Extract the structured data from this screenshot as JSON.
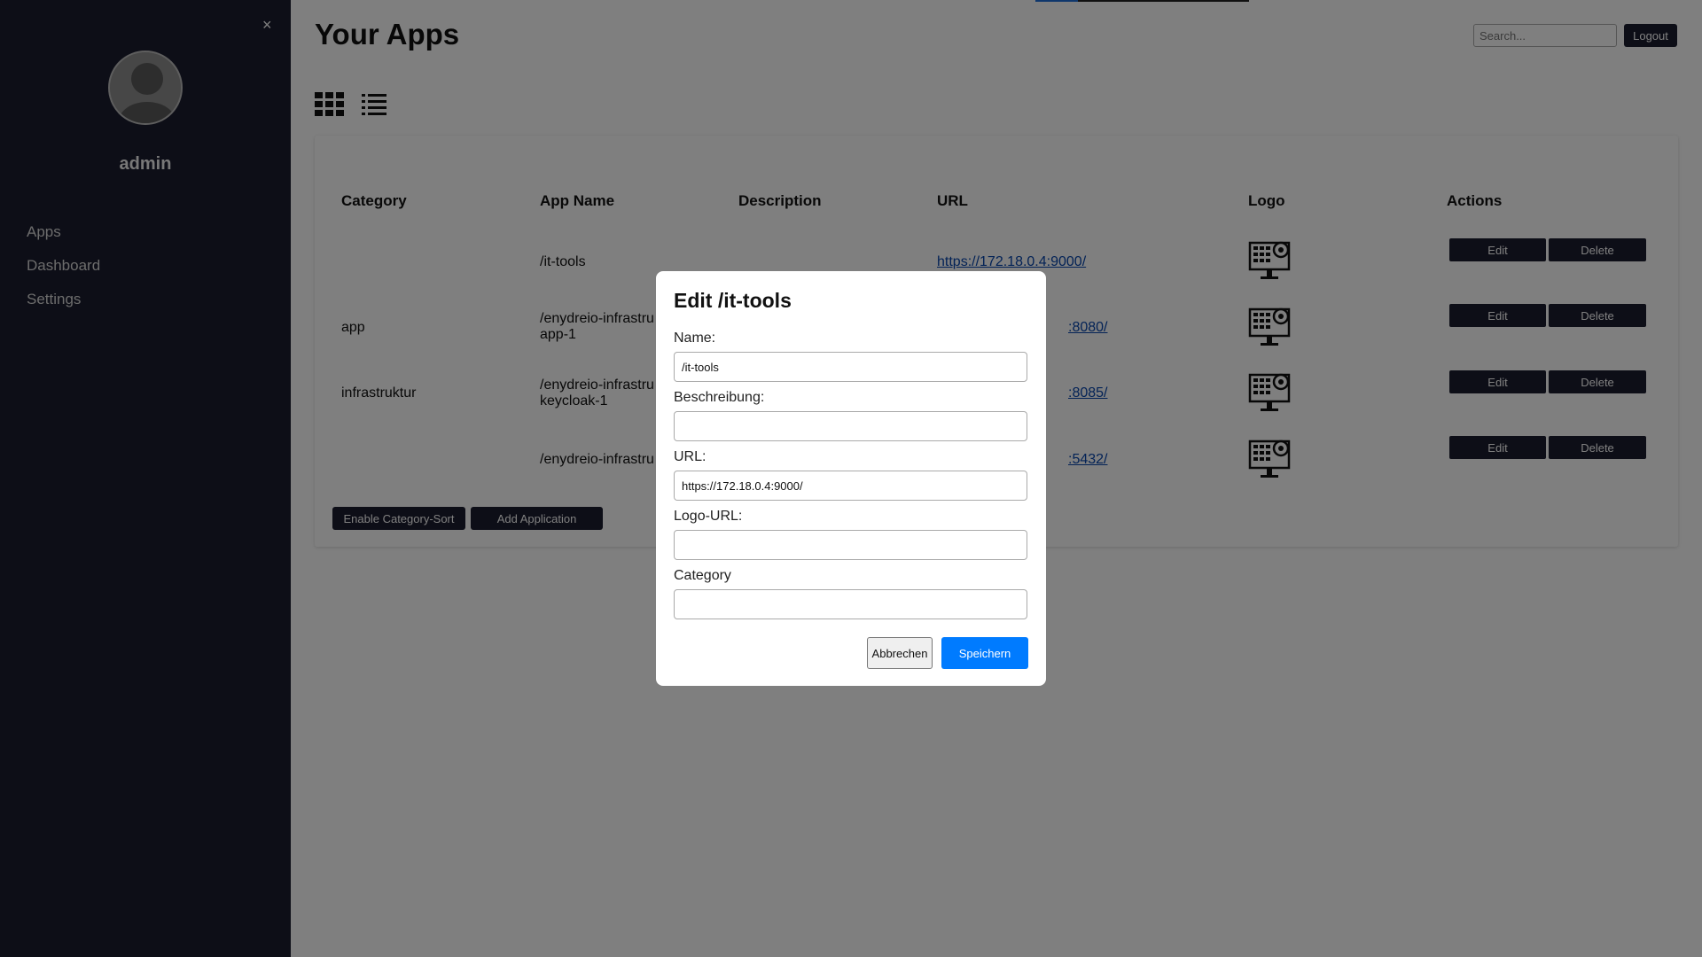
{
  "sidebar": {
    "close_label": "×",
    "username": "admin",
    "items": [
      {
        "label": "Apps"
      },
      {
        "label": "Dashboard"
      },
      {
        "label": "Settings"
      }
    ]
  },
  "header": {
    "title": "Your Apps",
    "search_placeholder": "Search...",
    "logout_label": "Logout"
  },
  "view_toggle": {
    "grid_icon": "grid-icon",
    "list_icon": "list-icon"
  },
  "table": {
    "headers": [
      "Category",
      "App Name",
      "Description",
      "URL",
      "Logo",
      "Actions"
    ],
    "rows": [
      {
        "category": "",
        "name_line1": "/it-tools",
        "name_line2": "",
        "description": "",
        "url": "https://172.18.0.4:9000/"
      },
      {
        "category": "app",
        "name_line1": "/enydreio-infrastru",
        "name_line2": "app-1",
        "description": "",
        "url": ":8080/"
      },
      {
        "category": "infrastruktur",
        "name_line1": "/enydreio-infrastru",
        "name_line2": "keycloak-1",
        "description": "",
        "url": ":8085/"
      },
      {
        "category": "",
        "name_line1": "/enydreio-infrastru",
        "name_line2": "",
        "description": "",
        "url": ":5432/"
      }
    ],
    "edit_label": "Edit",
    "delete_label": "Delete"
  },
  "footer_buttons": {
    "enable_sort_label": "Enable Category-Sort",
    "add_label": "Add Application"
  },
  "modal": {
    "title": "Edit /it-tools",
    "name_label": "Name:",
    "name_value": "/it-tools",
    "description_label": "Beschreibung:",
    "description_value": "",
    "url_label": "URL:",
    "url_value": "https://172.18.0.4:9000/",
    "logo_label": "Logo-URL:",
    "logo_value": "",
    "category_label": "Category",
    "category_value": "",
    "cancel_label": "Abbrechen",
    "save_label": "Speichern"
  },
  "colors": {
    "sidebar_bg": "#1b1c2e",
    "button_dark": "#1b1c2e",
    "primary": "#007bff",
    "link": "#0645ad"
  }
}
